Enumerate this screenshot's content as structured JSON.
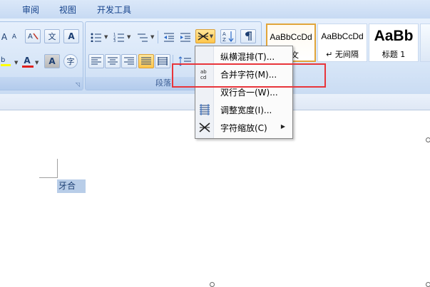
{
  "tabs": [
    {
      "label": "审阅"
    },
    {
      "label": "视图"
    },
    {
      "label": "开发工具"
    }
  ],
  "font_group": {
    "text_effect_label": "A",
    "grow_font_label": "A",
    "shrink_font_label": "A",
    "phonetic_label": "文",
    "char_border_label": "A",
    "font_color_label": "A",
    "char_shading_label": "A",
    "enclose_label": "字"
  },
  "paragraph_group": {
    "label": "段落"
  },
  "styles": [
    {
      "sample": "AaBbCcDd",
      "name": "正文"
    },
    {
      "sample": "AaBbCcDd",
      "name": "↵ 无间隔"
    },
    {
      "sample": "AaBb",
      "name": "标题 1"
    }
  ],
  "menu": {
    "items": [
      {
        "label": "纵横混排(T)..."
      },
      {
        "label": "合并字符(M)..."
      },
      {
        "label": "双行合一(W)..."
      },
      {
        "label": "调整宽度(I)..."
      },
      {
        "label": "字符缩放(C)"
      }
    ]
  },
  "document": {
    "selected_text": "牙合"
  },
  "colors": {
    "highlight": "#e8353b",
    "ribbon": "#d9e7f8",
    "selection": "#b8cde8"
  }
}
